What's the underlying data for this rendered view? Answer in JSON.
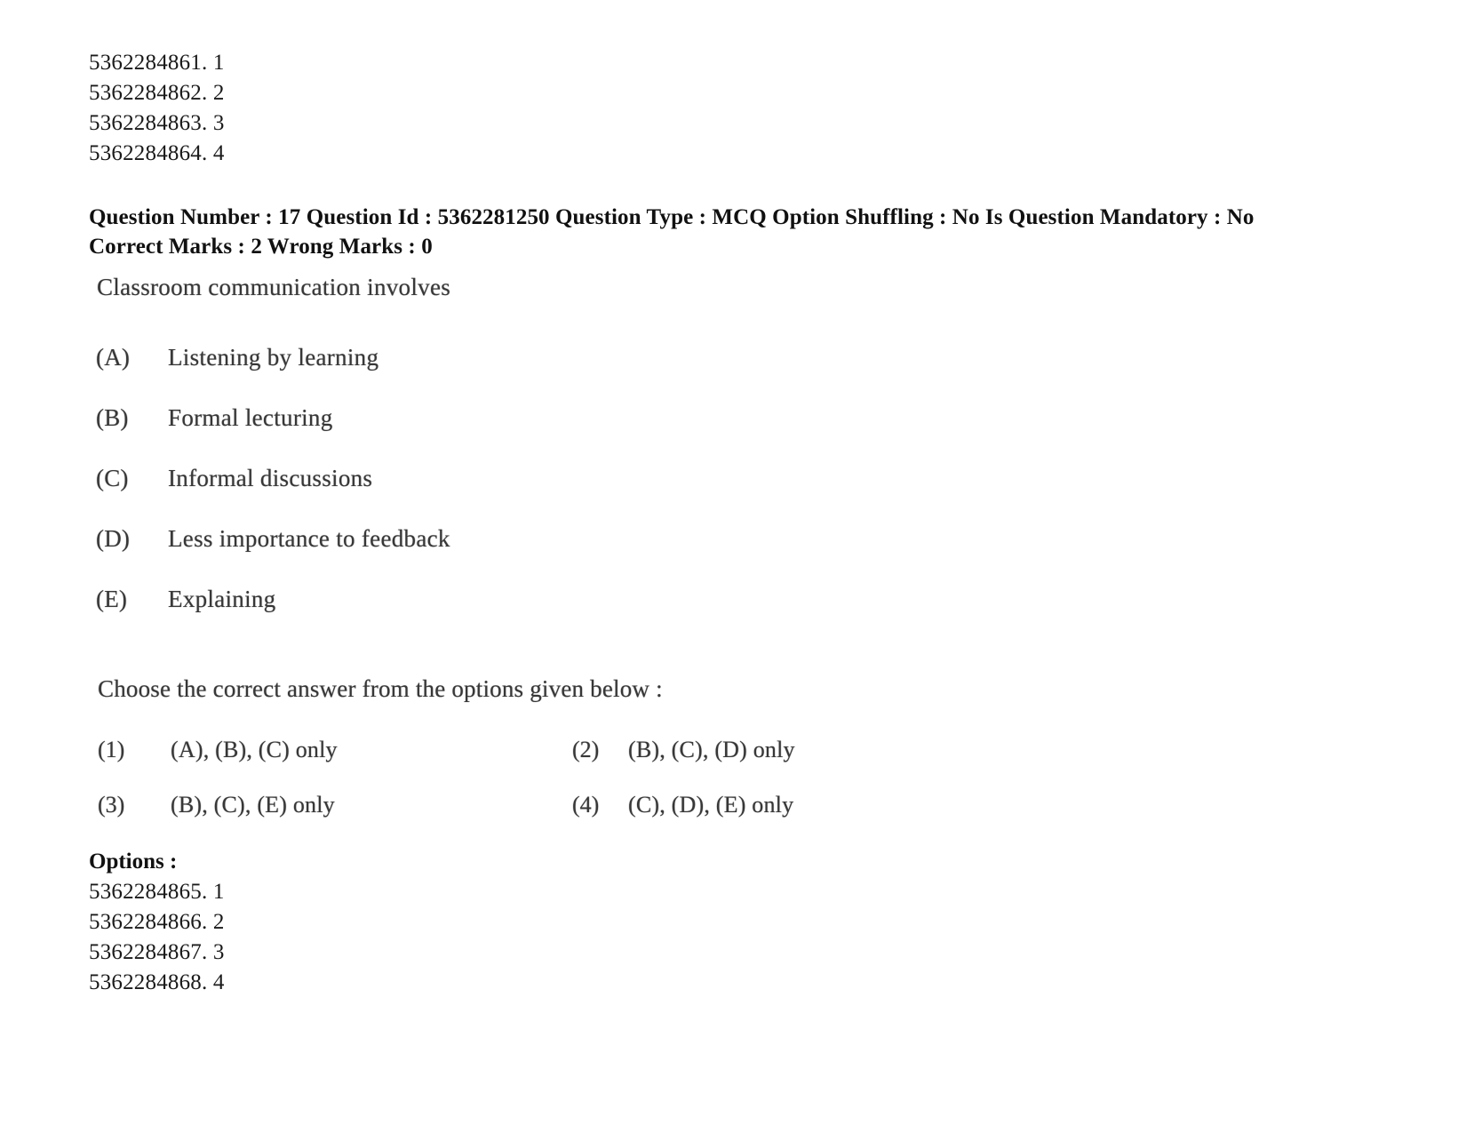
{
  "top_option_ids": [
    "5362284861. 1",
    "5362284862. 2",
    "5362284863. 3",
    "5362284864. 4"
  ],
  "question_meta": {
    "line1": "Question Number : 17 Question Id : 5362281250 Question Type : MCQ Option Shuffling : No Is Question Mandatory : No",
    "line2": "Correct Marks : 2 Wrong Marks : 0",
    "question_number": "17",
    "question_id": "5362281250",
    "question_type": "MCQ",
    "option_shuffling": "No",
    "is_question_mandatory": "No",
    "correct_marks": "2",
    "wrong_marks": "0"
  },
  "question": {
    "stem": "Classroom communication involves",
    "statements": [
      {
        "letter": "(A)",
        "text": "Listening by learning"
      },
      {
        "letter": "(B)",
        "text": "Formal lecturing"
      },
      {
        "letter": "(C)",
        "text": "Informal discussions"
      },
      {
        "letter": "(D)",
        "text": "Less importance to feedback"
      },
      {
        "letter": "(E)",
        "text": "Explaining"
      }
    ],
    "instruction": "Choose the correct answer from the options given below :",
    "answers": [
      {
        "number": "(1)",
        "text": "(A), (B), (C) only"
      },
      {
        "number": "(2)",
        "text": "(B), (C), (D) only"
      },
      {
        "number": "(3)",
        "text": "(B), (C), (E) only"
      },
      {
        "number": "(4)",
        "text": "(C), (D), (E) only"
      }
    ]
  },
  "options_section": {
    "label": "Options :",
    "option_ids": [
      "5362284865. 1",
      "5362284866. 2",
      "5362284867. 3",
      "5362284868. 4"
    ]
  }
}
